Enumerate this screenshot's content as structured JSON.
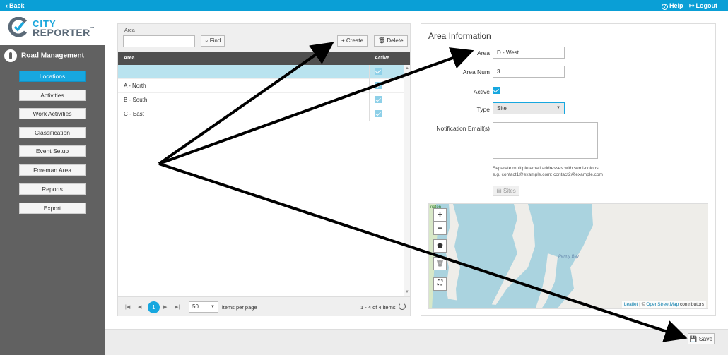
{
  "topbar": {
    "back": "Back",
    "help": "Help",
    "logout": "Logout"
  },
  "logo": {
    "line1": "CITY",
    "line2": "REPORTER",
    "tm": "™"
  },
  "sidebar": {
    "module_title": "Road Management",
    "items": [
      {
        "label": "Locations",
        "active": true
      },
      {
        "label": "Activities",
        "active": false
      },
      {
        "label": "Work Activities",
        "active": false
      },
      {
        "label": "Classification",
        "active": false
      },
      {
        "label": "Event Setup",
        "active": false
      },
      {
        "label": "Foreman Area",
        "active": false
      },
      {
        "label": "Reports",
        "active": false
      },
      {
        "label": "Export",
        "active": false
      }
    ]
  },
  "list_panel": {
    "search_label": "Area",
    "search_value": "",
    "find_label": "Find",
    "create_label": "Create",
    "delete_label": "Delete",
    "columns": [
      "Area",
      "Active"
    ],
    "rows": [
      {
        "name": "",
        "active": true,
        "selected": true
      },
      {
        "name": "A - North",
        "active": true,
        "selected": false
      },
      {
        "name": "B - South",
        "active": true,
        "selected": false
      },
      {
        "name": "C - East",
        "active": true,
        "selected": false
      }
    ],
    "pager": {
      "current_page": "1",
      "page_size": "50",
      "items_per_page_label": "items per page",
      "info": "1 - 4 of 4 items"
    }
  },
  "info_panel": {
    "title": "Area Information",
    "area_label": "Area",
    "area_value": "D - West",
    "area_num_label": "Area Num",
    "area_num_value": "3",
    "active_label": "Active",
    "active_value": true,
    "type_label": "Type",
    "type_value": "Site",
    "email_label": "Notification Email(s)",
    "email_value": "",
    "hint_line1": "Separate multiple email addresses with semi-colons.",
    "hint_line2": "e.g. contact1@example.com; contact2@example.com",
    "sites_label": "Sites"
  },
  "map": {
    "zoom_in": "+",
    "zoom_out": "−",
    "attribution_leaflet": "Leaflet",
    "attribution_sep": " | © ",
    "attribution_osm": "OpenStreetMap",
    "attribution_suffix": " contributors",
    "top_label": "ngton",
    "water_label": "Penny Bay"
  },
  "footer": {
    "save_label": "Save"
  },
  "colors": {
    "accent": "#17a7df",
    "topbar": "#0a9fd6",
    "sidebar": "#616161",
    "water": "#aad3df",
    "land": "#eeede9"
  }
}
